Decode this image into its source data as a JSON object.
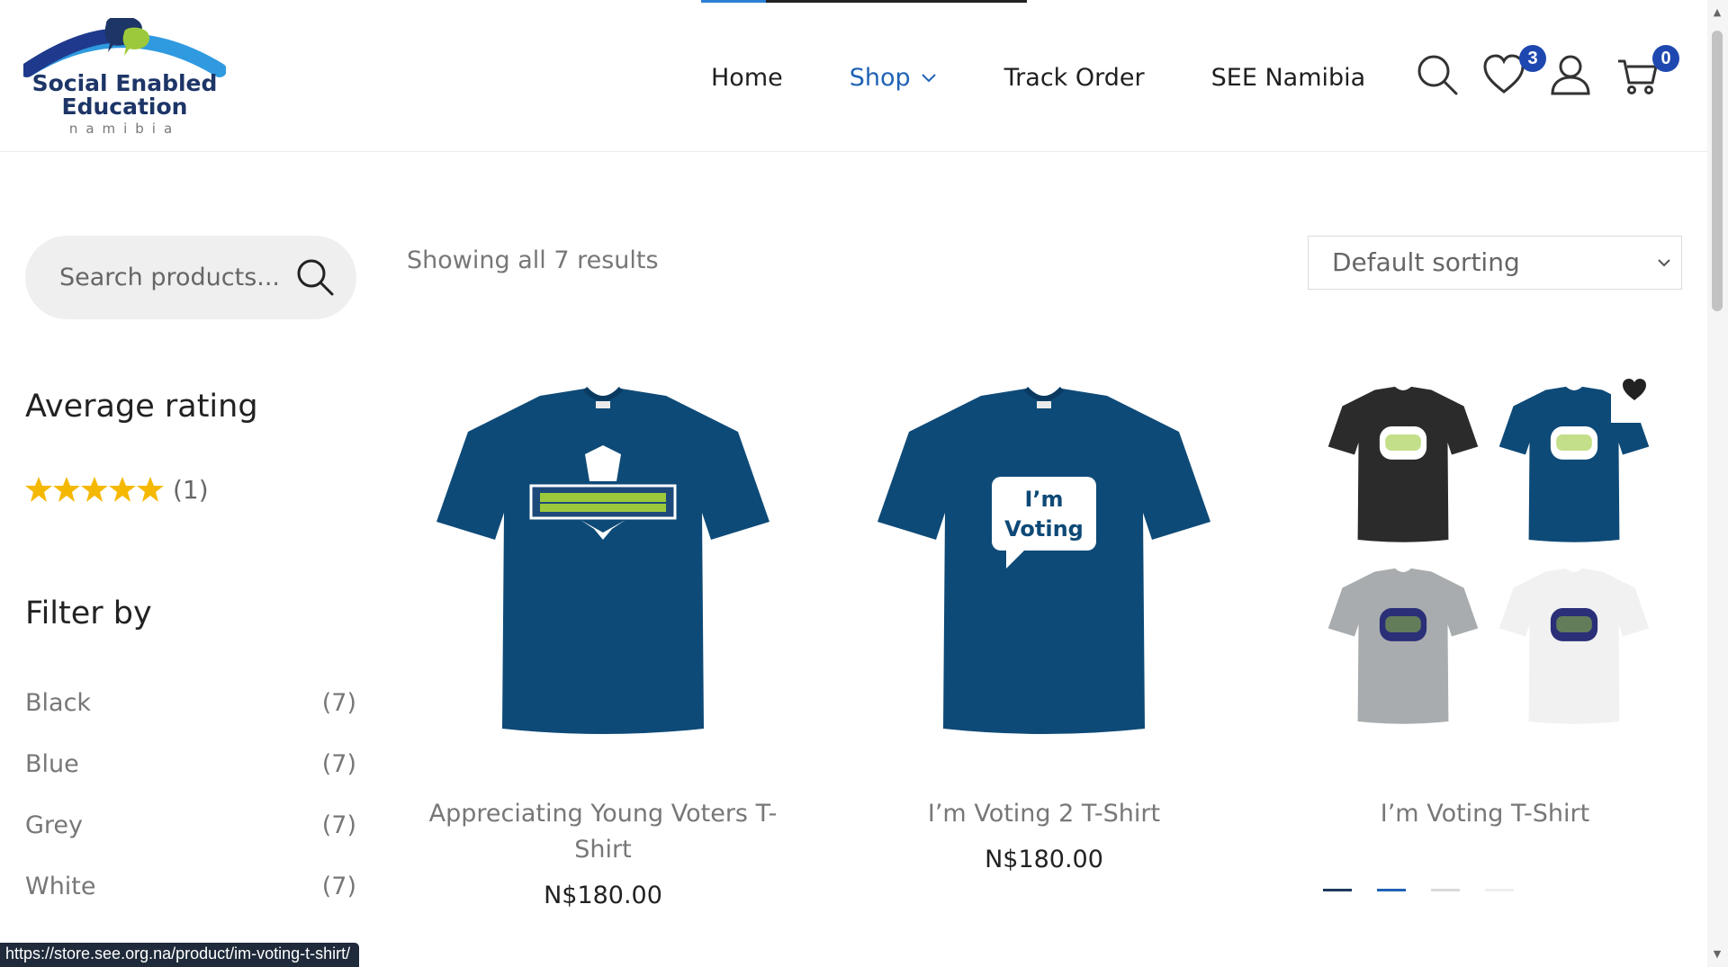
{
  "brand": {
    "line1": "Social Enabled",
    "line2": "Education",
    "line3": "namibia",
    "colors": {
      "arc_dark": "#1f3a8c",
      "arc_light": "#2f9ae0",
      "bubble_green": "#9cc93b",
      "bubble_navy": "#1d3567"
    }
  },
  "page_loading_progress": 0.2,
  "nav": {
    "items": [
      {
        "label": "Home"
      },
      {
        "label": "Shop"
      },
      {
        "label": "Track Order"
      },
      {
        "label": "SEE Namibia"
      }
    ],
    "active": "Shop"
  },
  "header_icons": {
    "search": "search-icon",
    "wishlist": "heart-icon",
    "wishlist_count": "3",
    "account": "user-icon",
    "cart": "cart-icon",
    "cart_count": "0"
  },
  "sidebar": {
    "search_placeholder": "Search products...",
    "rating_heading": "Average rating",
    "rating_stars": 5,
    "rating_count": "(1)",
    "filter_heading": "Filter by",
    "filters": [
      {
        "label": "Black",
        "count": "(7)"
      },
      {
        "label": "Blue",
        "count": "(7)"
      },
      {
        "label": "Grey",
        "count": "(7)"
      },
      {
        "label": "White",
        "count": "(7)"
      }
    ]
  },
  "main": {
    "results_text": "Showing all 7 results",
    "sort_selected": "Default sorting",
    "products": [
      {
        "title": "Appreciating Young Voters T-Shirt",
        "price": "N$180.00",
        "shirt_color": "#0e4a77"
      },
      {
        "title": "I’m Voting 2 T-Shirt",
        "price": "N$180.00",
        "shirt_color": "#0e4a77",
        "print_text_1": "I’m",
        "print_text_2": "Voting"
      },
      {
        "title": "I’m Voting T-Shirt",
        "price": "",
        "variants": [
          "#2b2b2b",
          "#0e4a77",
          "#a9acae",
          "#f1f1f1"
        ]
      }
    ],
    "gallery_dot_colors": [
      "#1e3a5c",
      "#1f62b5",
      "#d9d9d9",
      "#eeeeee"
    ]
  },
  "status_bar_url": "https://store.see.org.na/product/im-voting-t-shirt/"
}
